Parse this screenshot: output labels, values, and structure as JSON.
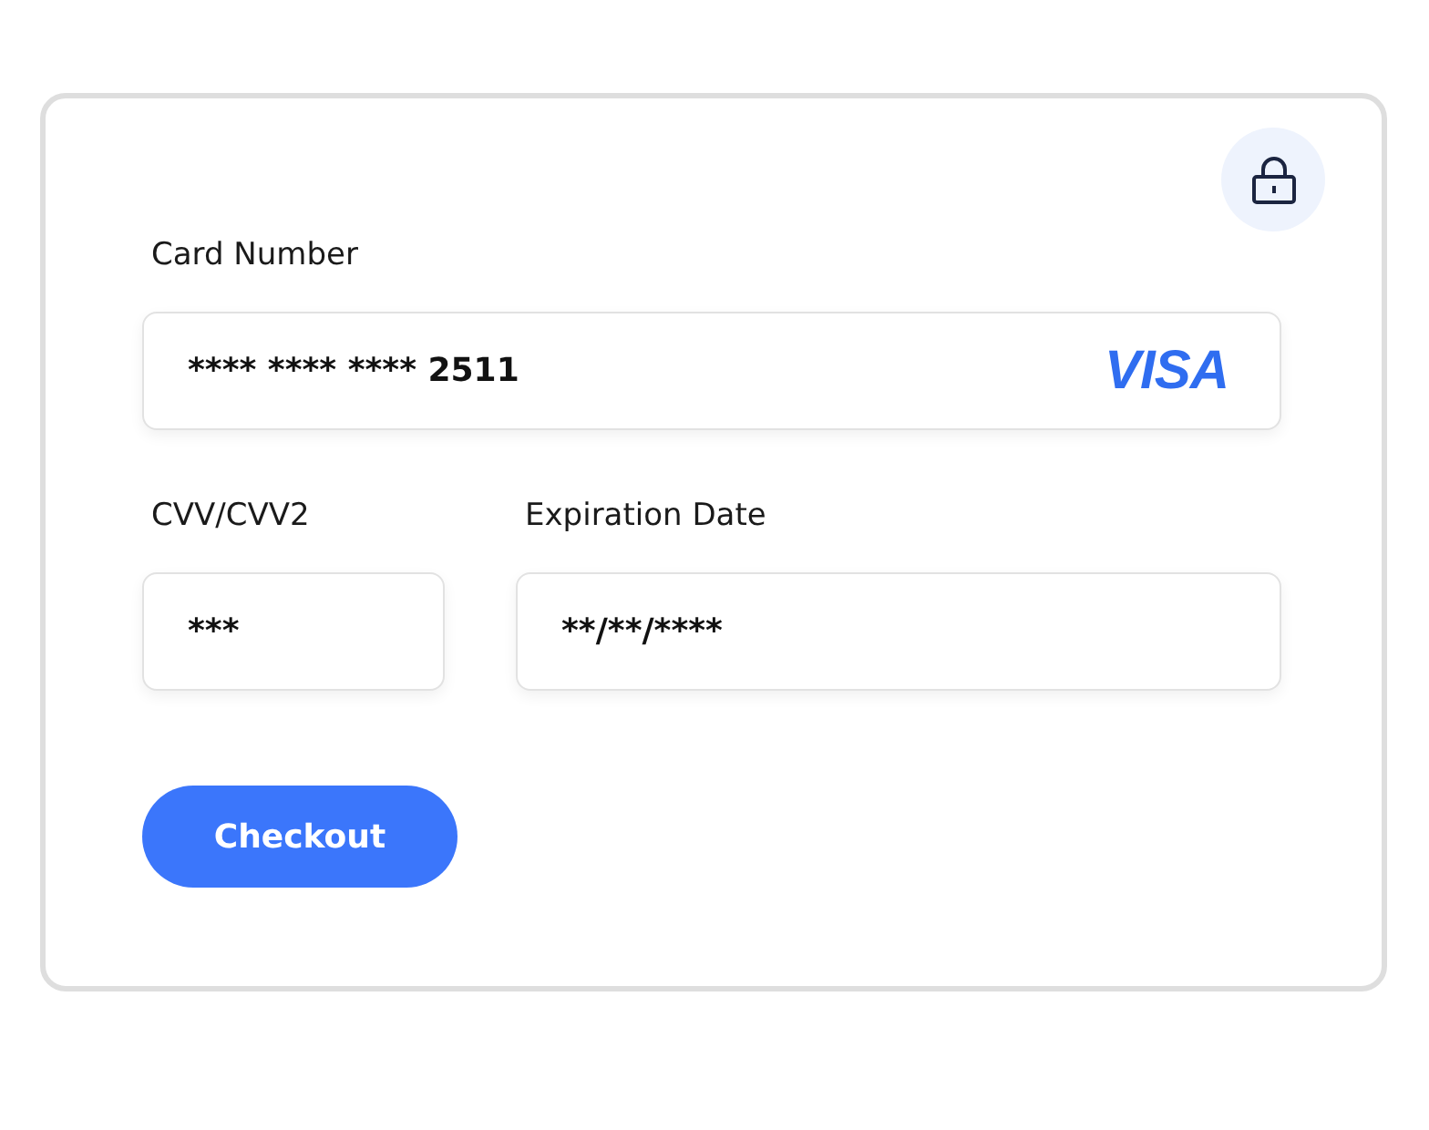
{
  "card_number": {
    "label": "Card Number",
    "value": "**** **** **** 2511",
    "brand": "VISA"
  },
  "cvv": {
    "label": "CVV/CVV2",
    "value": "***"
  },
  "expiration": {
    "label": "Expiration Date",
    "value": "**/**/****"
  },
  "button": {
    "label": "Checkout"
  }
}
